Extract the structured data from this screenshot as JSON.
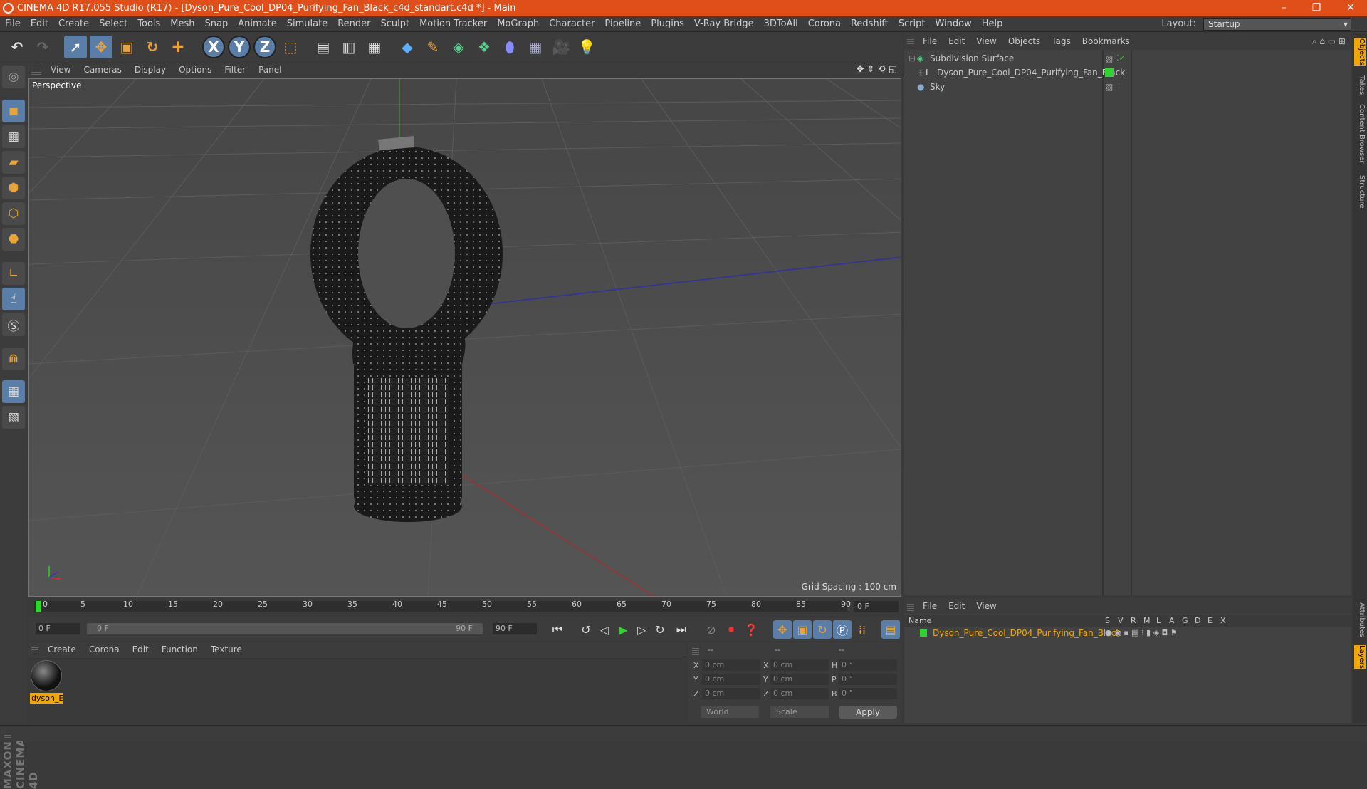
{
  "window": {
    "title": "CINEMA 4D R17.055 Studio (R17) - [Dyson_Pure_Cool_DP04_Purifying_Fan_Black_c4d_standart.c4d *] - Main",
    "minimize": "–",
    "maximize": "❐",
    "close": "✕"
  },
  "menu": [
    "File",
    "Edit",
    "Create",
    "Select",
    "Tools",
    "Mesh",
    "Snap",
    "Animate",
    "Simulate",
    "Render",
    "Sculpt",
    "Motion Tracker",
    "MoGraph",
    "Character",
    "Pipeline",
    "Plugins",
    "V-Ray Bridge",
    "3DToAll",
    "Corona",
    "Redshift",
    "Script",
    "Window",
    "Help"
  ],
  "layout": {
    "label": "Layout:",
    "value": "Startup"
  },
  "toolbar": {
    "x_axis": "X",
    "y_axis": "Y",
    "z_axis": "Z"
  },
  "viewport": {
    "menu": [
      "View",
      "Cameras",
      "Display",
      "Options",
      "Filter",
      "Panel"
    ],
    "label": "Perspective",
    "grid_spacing": "Grid Spacing : 100 cm"
  },
  "timeline": {
    "ticks": [
      "0",
      "5",
      "10",
      "15",
      "20",
      "25",
      "30",
      "35",
      "40",
      "45",
      "50",
      "55",
      "60",
      "65",
      "70",
      "75",
      "80",
      "85",
      "90"
    ],
    "current_frame": "0 F"
  },
  "playback": {
    "start": "0 F",
    "range_start": "0 F",
    "range_end": "90 F",
    "end": "90 F"
  },
  "material_manager": {
    "menu": [
      "Create",
      "Corona",
      "Edit",
      "Function",
      "Texture"
    ],
    "materials": [
      "dyson_E"
    ]
  },
  "coordinates": {
    "headers": [
      "--",
      "--",
      "--"
    ],
    "rows": [
      {
        "l1": "X",
        "v1": "0 cm",
        "l2": "X",
        "v2": "0 cm",
        "l3": "H",
        "v3": "0 °"
      },
      {
        "l1": "Y",
        "v1": "0 cm",
        "l2": "Y",
        "v2": "0 cm",
        "l3": "P",
        "v3": "0 °"
      },
      {
        "l1": "Z",
        "v1": "0 cm",
        "l2": "Z",
        "v2": "0 cm",
        "l3": "B",
        "v3": "0 °"
      }
    ],
    "mode": "World",
    "scale": "Scale",
    "apply": "Apply"
  },
  "object_manager": {
    "menu": [
      "File",
      "Edit",
      "View",
      "Objects",
      "Tags",
      "Bookmarks"
    ],
    "objects": [
      "Subdivision Surface",
      "Dyson_Pure_Cool_DP04_Purifying_Fan_Black",
      "Sky"
    ]
  },
  "layer_manager": {
    "menu": [
      "File",
      "Edit",
      "View"
    ],
    "columns": [
      "Name",
      "S",
      "V",
      "R",
      "M",
      "L",
      "A",
      "G",
      "D",
      "E",
      "X"
    ],
    "layer": "Dyson_Pure_Cool_DP04_Purifying_Fan_Black"
  },
  "right_tabs": [
    "Objects",
    "Takes",
    "Content Browser",
    "Structure",
    "Attributes",
    "Layers"
  ],
  "branding": "MAXON CINEMA 4D",
  "colors": {
    "titlebar": "#e04f1a",
    "accent": "#f0a800",
    "selected_tool": "#5b7ea8"
  }
}
